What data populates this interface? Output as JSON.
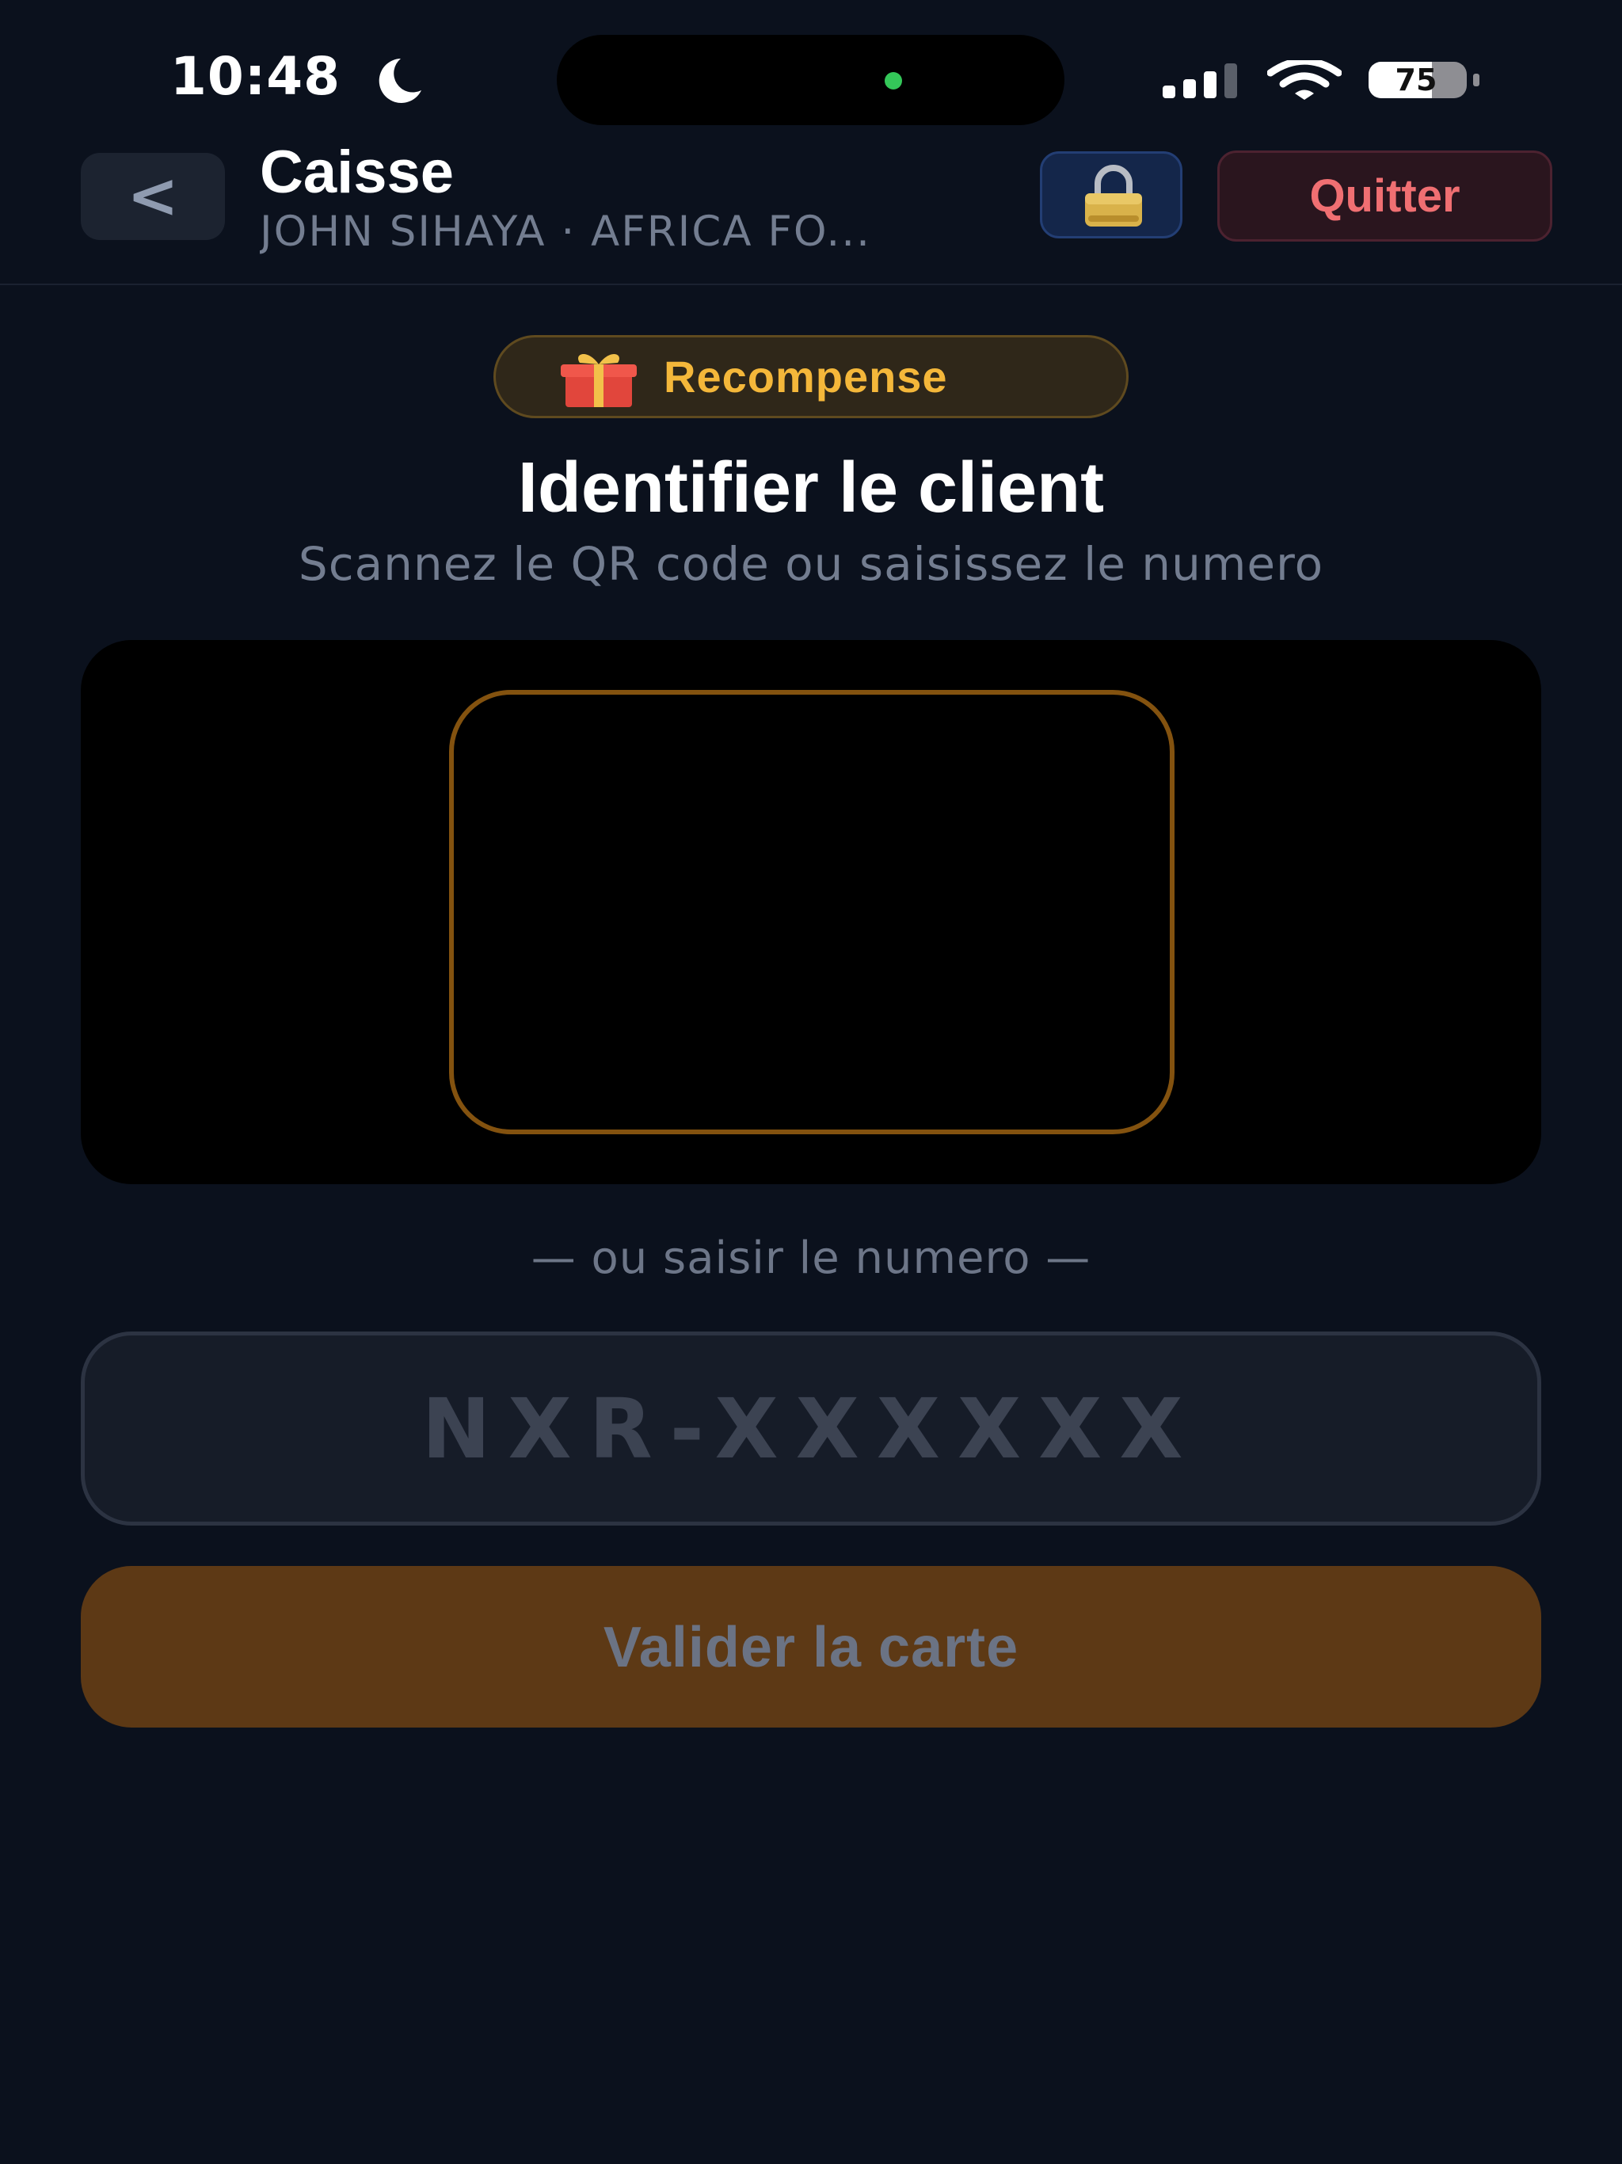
{
  "status_bar": {
    "time": "10:48",
    "battery_level": "75"
  },
  "header": {
    "back_label": "<",
    "title": "Caisse",
    "subtitle": "JOHN SIHAYA · AFRICA FO...",
    "quit_label": "Quitter"
  },
  "badge": {
    "label": "Recompense"
  },
  "main": {
    "heading": "Identifier le client",
    "subheading": "Scannez le QR code ou saisissez le numero"
  },
  "manual_entry": {
    "divider_text": "— ou saisir le numero —",
    "card_number_value": "",
    "card_number_placeholder": "NXR-XXXXXX",
    "validate_label": "Valider la carte"
  },
  "icons": {
    "do_not_disturb": "moon-icon",
    "cellular": "signal-icon",
    "wifi": "wifi-icon",
    "battery": "battery-icon",
    "lock": "lock-icon",
    "gift": "gift-icon"
  },
  "colors": {
    "background": "#0b111d",
    "accent_gold": "#f4b73a",
    "scan_frame": "#83520f",
    "validate_button": "#5d3915",
    "danger_text": "#f06f72",
    "muted_text": "#737d90"
  }
}
